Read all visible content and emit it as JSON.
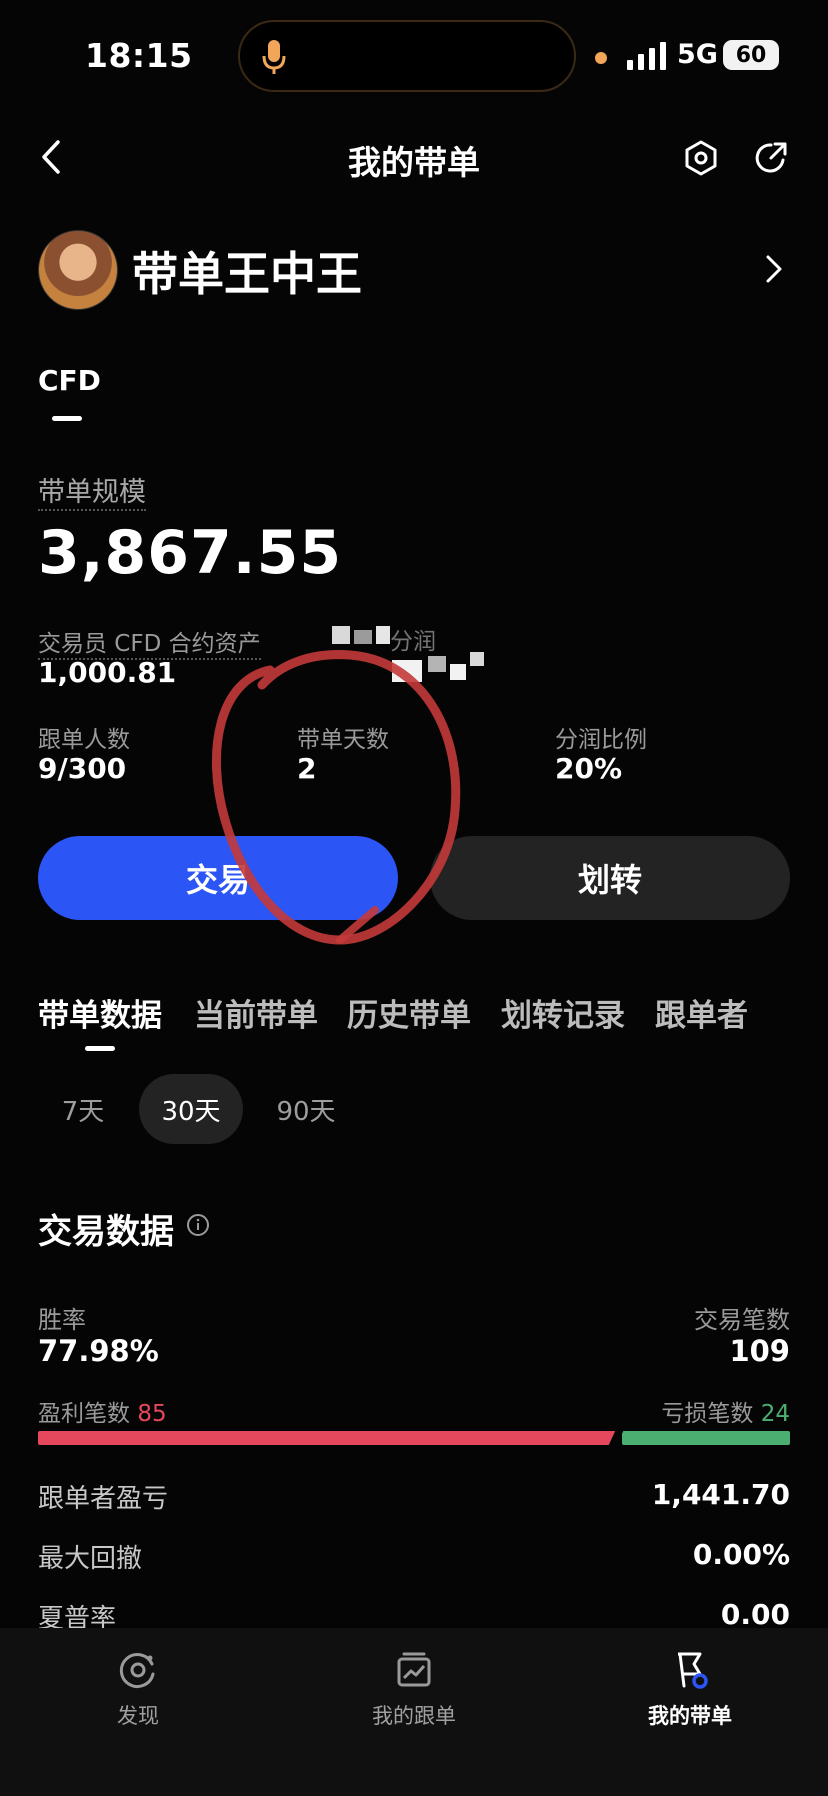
{
  "status_bar": {
    "time": "18:15",
    "network": "5G",
    "battery": "60"
  },
  "header": {
    "title": "我的带单",
    "back_icon": "chevron-left-icon",
    "settings_icon": "hexagon-settings-icon",
    "share_icon": "share-icon"
  },
  "profile": {
    "name": "带单王中王"
  },
  "account_tab": {
    "label": "CFD"
  },
  "summary": {
    "scale_label": "带单规模",
    "scale_value": "3,867.55",
    "asset_label": "交易员 CFD 合约资产",
    "asset_value": "1,000.81",
    "profit_share_label": "分润",
    "followers_label": "跟单人数",
    "followers_value": "9/300",
    "days_label": "带单天数",
    "days_value": "2",
    "ratio_label": "分润比例",
    "ratio_value": "20%"
  },
  "buttons": {
    "trade": "交易",
    "transfer": "划转"
  },
  "tabs": [
    "带单数据",
    "当前带单",
    "历史带单",
    "划转记录",
    "跟单者"
  ],
  "periods": [
    "7天",
    "30天",
    "90天"
  ],
  "trade_data": {
    "title": "交易数据",
    "win_rate_label": "胜率",
    "win_rate_value": "77.98%",
    "trades_label": "交易笔数",
    "trades_value": "109",
    "profit_count_label": "盈利笔数",
    "profit_count": "85",
    "loss_count_label": "亏损笔数",
    "loss_count": "24",
    "profit_fraction": 0.7798,
    "follower_pnl_label": "跟单者盈亏",
    "follower_pnl_value": "1,441.70",
    "max_drawdown_label": "最大回撤",
    "max_drawdown_value": "0.00%",
    "sharpe_label": "夏普率",
    "sharpe_value": "0.00"
  },
  "bottom_nav": [
    {
      "label": "发现",
      "icon": "discover-icon"
    },
    {
      "label": "我的跟单",
      "icon": "chart-board-icon"
    },
    {
      "label": "我的带单",
      "icon": "flag-badge-icon"
    }
  ],
  "colors": {
    "accent": "#2b55f5",
    "profit": "#e5485c",
    "loss": "#4caf72",
    "annotation": "#c43a3a"
  }
}
